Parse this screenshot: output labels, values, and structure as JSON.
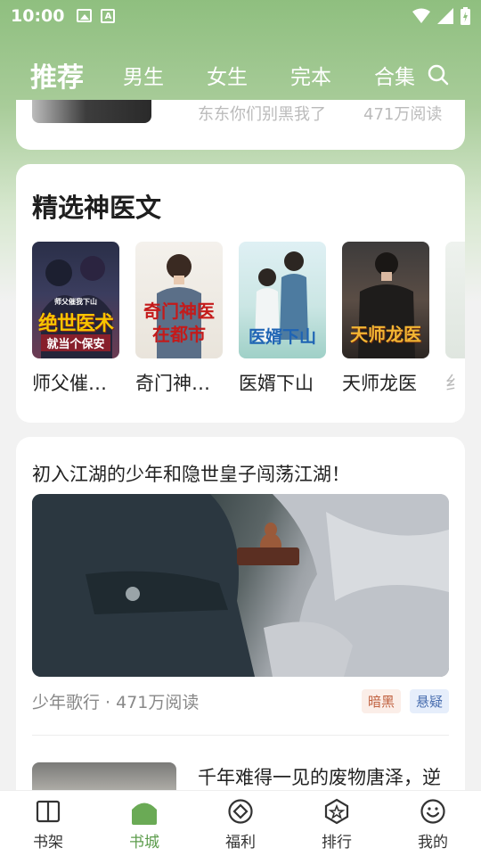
{
  "status_bar": {
    "time": "10:00"
  },
  "top_nav": {
    "tabs": [
      {
        "label": "推荐",
        "active": true
      },
      {
        "label": "男生"
      },
      {
        "label": "女生"
      },
      {
        "label": "完本"
      },
      {
        "label": "合集"
      }
    ]
  },
  "previous_item": {
    "author": "东东你们别黑我了",
    "reads": "471万阅读"
  },
  "selection": {
    "title": "精选神医文",
    "books": [
      {
        "title": "师父催我下山",
        "display_title": "师父催…",
        "cover_text_top": "师父催我下山",
        "cover_text_main": "绝世医术",
        "cover_text_sub": "就当个保安"
      },
      {
        "title": "奇门神医在都市",
        "display_title": "奇门神…",
        "cover_text_main": "奇门神医",
        "cover_text_sub": "在都市"
      },
      {
        "title": "医婿下山",
        "display_title": "医婿下山",
        "cover_text_main": "医婿下山"
      },
      {
        "title": "天师龙医",
        "display_title": "天师龙医",
        "cover_text_main": "天师龙医"
      }
    ],
    "partial_next_title": "纟"
  },
  "feature": {
    "headline": "初入江湖的少年和隐世皇子闯荡江湖！",
    "meta": "少年歌行 · 471万阅读",
    "tags": [
      "暗黑",
      "悬疑"
    ]
  },
  "next_item": {
    "description": "千年难得一见的废物唐泽，逆"
  },
  "bottom_nav": {
    "items": [
      {
        "label": "书架",
        "icon": "book-icon"
      },
      {
        "label": "书城",
        "icon": "home-icon",
        "active": true
      },
      {
        "label": "福利",
        "icon": "diamond-icon"
      },
      {
        "label": "排行",
        "icon": "star-badge-icon"
      },
      {
        "label": "我的",
        "icon": "smile-icon"
      }
    ]
  },
  "colors": {
    "accent": "#5c9c4c",
    "header_green": "#8fbf7f"
  }
}
